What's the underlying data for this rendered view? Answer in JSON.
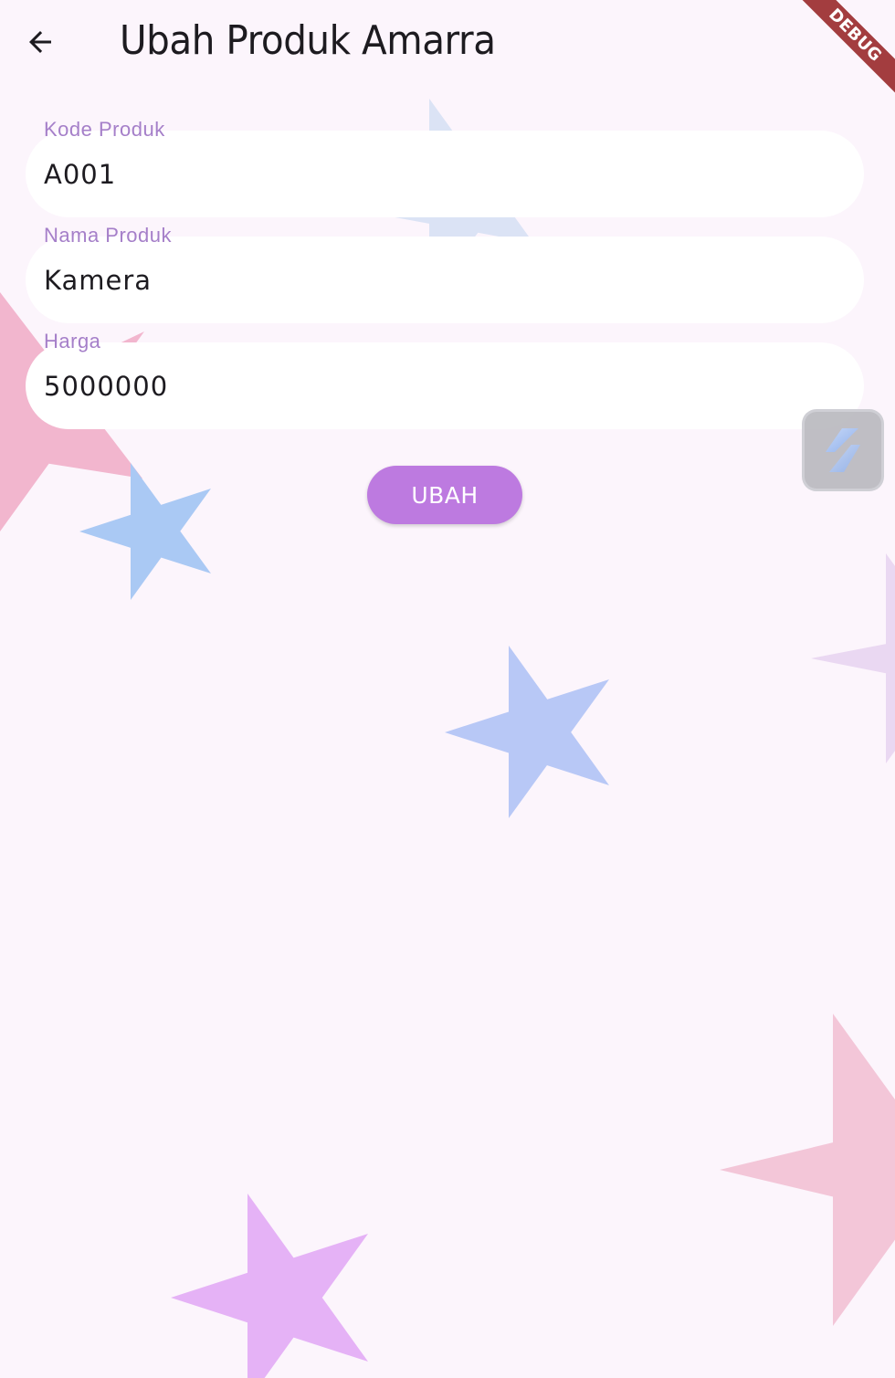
{
  "app_bar": {
    "title": "Ubah Produk Amarra",
    "back_icon": "arrow-back-icon"
  },
  "debug_banner": {
    "label": "DEBUG"
  },
  "form": {
    "fields": [
      {
        "label": "Kode Produk",
        "value": "A001"
      },
      {
        "label": "Nama Produk",
        "value": "Kamera"
      },
      {
        "label": "Harga",
        "value": "5000000"
      }
    ],
    "submit_label": "UBAH"
  },
  "floating_tool": {
    "icon": "flutter-inspector-icon"
  },
  "colors": {
    "background": "#fcf5fc",
    "label": "#a57fc9",
    "button": "#bd7ae0",
    "debug_ribbon": "#a33d3f"
  }
}
